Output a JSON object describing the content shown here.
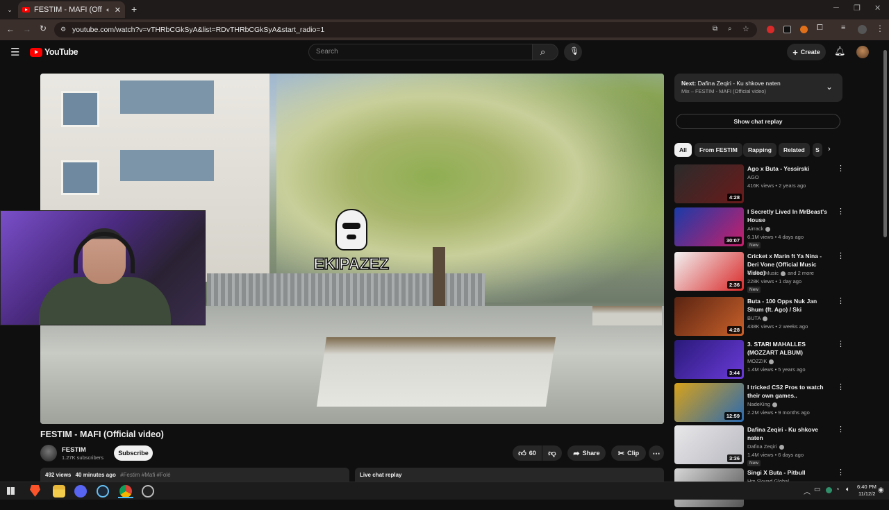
{
  "browser": {
    "tab_title": "FESTIM - MAFI (Official video)",
    "url": "youtube.com/watch?v=vTHRbCGkSyA&list=RDvTHRbCGkSyA&start_radio=1"
  },
  "header": {
    "logo_text": "YouTube",
    "search_placeholder": "Search",
    "create_label": "Create"
  },
  "player": {
    "overlay_logo_text": "EKIPAZEZ"
  },
  "video": {
    "title": "FESTIM - MAFI (Official video)",
    "channel": "FESTIM",
    "subscribers": "1.27K subscribers",
    "subscribe_label": "Subscribe",
    "likes": "60",
    "share_label": "Share",
    "clip_label": "Clip",
    "views": "492 views",
    "age": "40 minutes ago",
    "hashtags": "#Festim #Mafi #Folé",
    "live_chat_label": "Live chat replay"
  },
  "sidebar": {
    "next_label": "Next:",
    "next_title": "Dafina Zeqiri - Ku shkove naten",
    "next_sub": "Mix – FESTIM - MAFI (Official video)",
    "chat_replay_label": "Show chat replay",
    "chips": [
      "All",
      "From FESTIM",
      "Rapping",
      "Related",
      "S"
    ],
    "recs": [
      {
        "title": "Ago x Buta - Yessirski",
        "channel": "AGO",
        "verified": false,
        "stats": "416K views • 2 years ago",
        "duration": "4:28",
        "is_new": false,
        "thumb_color": "#2b2b2b",
        "thumb_color2": "#6b1a1a"
      },
      {
        "title": "I Secretly Lived In MrBeast's House",
        "channel": "Airrack",
        "verified": true,
        "stats": "6.1M views • 4 days ago",
        "duration": "30:07",
        "is_new": true,
        "thumb_color": "#1a3ba8",
        "thumb_color2": "#c71f6a"
      },
      {
        "title": "Cricket x Marin ft Ya Nina - Deri Vone (Official Music Video)",
        "channel": "Cricket Music",
        "verified": true,
        "channel_extra": "and 2 more",
        "stats": "228K views • 1 day ago",
        "duration": "2:36",
        "is_new": true,
        "thumb_color": "#f2f2f2",
        "thumb_color2": "#d92a2a"
      },
      {
        "title": "Buta - 100 Opps Nuk Jan Shum (ft. Ago) / Ski",
        "channel": "BUTA",
        "verified": true,
        "stats": "438K views • 2 weeks ago",
        "duration": "4:28",
        "is_new": false,
        "thumb_color": "#5a2412",
        "thumb_color2": "#c8602a"
      },
      {
        "title": "3. STARI MAHALLES (MOZZART ALBUM)",
        "channel": "MOZZIK",
        "verified": true,
        "stats": "1.4M views • 5 years ago",
        "duration": "3:44",
        "is_new": false,
        "thumb_color": "#2a1a7a",
        "thumb_color2": "#6a3ad8"
      },
      {
        "title": "I tricked CS2 Pros to watch their own games..",
        "channel": "NadeKing",
        "verified": true,
        "stats": "2.2M views • 9 months ago",
        "duration": "12:59",
        "is_new": false,
        "thumb_color": "#d8a21a",
        "thumb_color2": "#2a6ab0"
      },
      {
        "title": "Dafina Zeqiri - Ku shkove naten",
        "channel": "Dafina Zeqiri",
        "verified": true,
        "stats": "1.4M views • 6 days ago",
        "duration": "3:36",
        "is_new": true,
        "thumb_color": "#e8e8ea",
        "thumb_color2": "#b8b8c0"
      },
      {
        "title": "Singi X Buta - Pitbull",
        "channel": "Hm Skwad Global",
        "verified": false,
        "stats": "",
        "duration": "",
        "is_new": false,
        "thumb_color": "#d6d6d6",
        "thumb_color2": "#555555"
      }
    ],
    "new_label": "New"
  },
  "taskbar": {
    "time": "6:40 PM",
    "date": "11/12/2"
  },
  "colors": {
    "yt_red": "#ff0000",
    "bg": "#0f0f0f",
    "chip_active": "#f1f1f1"
  }
}
